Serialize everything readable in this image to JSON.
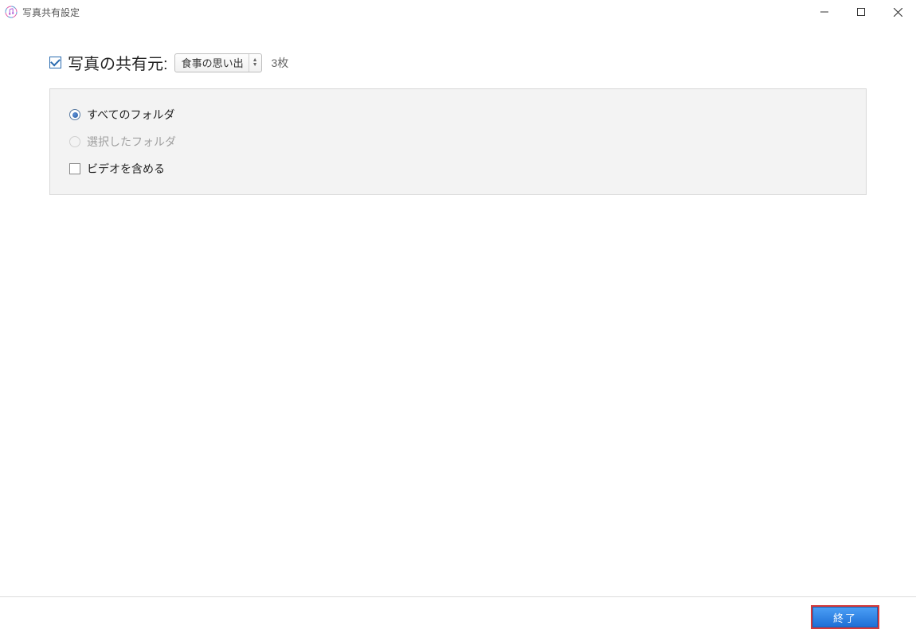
{
  "window": {
    "title": "写真共有設定"
  },
  "share": {
    "enable_label": "写真の共有元:",
    "source_selected": "食事の思い出",
    "count_text": "3枚"
  },
  "options": {
    "all_folders": "すべてのフォルダ",
    "selected_folders": "選択したフォルダ",
    "include_video": "ビデオを含める"
  },
  "footer": {
    "done_label": "終了"
  }
}
